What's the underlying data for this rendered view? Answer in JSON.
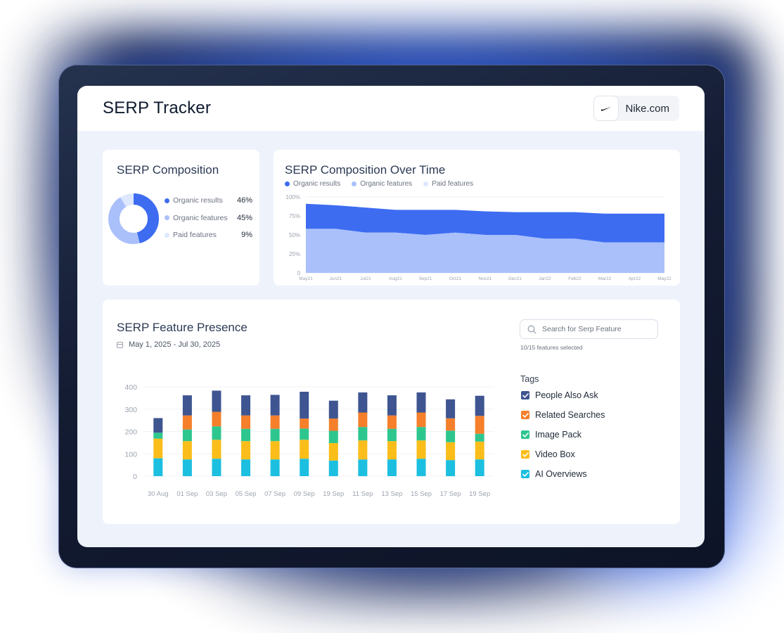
{
  "app": {
    "title": "SERP Tracker",
    "domain": "Nike.com"
  },
  "colors": {
    "organic_results": "#3d6cf1",
    "organic_features": "#a9c0fb",
    "paid_features": "#dde7fd",
    "people_also_ask": "#3e5591",
    "related_searches": "#f57f2b",
    "image_pack": "#2ec68f",
    "video_box": "#fbbd1a",
    "ai_overviews": "#1cbfe0"
  },
  "composition": {
    "title": "SERP Composition",
    "legend": [
      {
        "label": "Organic results",
        "pct": "46%",
        "value": 46,
        "color": "#3d6cf1"
      },
      {
        "label": "Organic features",
        "pct": "45%",
        "value": 45,
        "color": "#a9c0fb"
      },
      {
        "label": "Paid features",
        "pct": "9%",
        "value": 9,
        "color": "#dde7fd"
      }
    ]
  },
  "over_time": {
    "title": "SERP Composition Over Time",
    "legend": [
      {
        "label": "Organic results",
        "color": "#3d6cf1"
      },
      {
        "label": "Organic features",
        "color": "#a9c0fb"
      },
      {
        "label": "Paid features",
        "color": "#dde7fd"
      }
    ]
  },
  "presence": {
    "title": "SERP Feature Presence",
    "date_range": "May 1, 2025 - Jul 30, 2025",
    "search_placeholder": "Search for Serp Feature",
    "selected_count": "10/15 features selected",
    "tags_label": "Tags",
    "tags": [
      {
        "label": "People Also Ask",
        "color": "#3e5591",
        "checked": true
      },
      {
        "label": "Related Searches",
        "color": "#f57f2b",
        "checked": true
      },
      {
        "label": "Image Pack",
        "color": "#2ec68f",
        "checked": true
      },
      {
        "label": "Video Box",
        "color": "#fbbd1a",
        "checked": true
      },
      {
        "label": "AI Overviews",
        "color": "#1cbfe0",
        "checked": true
      }
    ]
  },
  "chart_data": [
    {
      "type": "area",
      "title": "SERP Composition Over Time",
      "x": [
        "May21",
        "Jun21",
        "Jul21",
        "Aug21",
        "Sep21",
        "Oct21",
        "Nov21",
        "Dec21",
        "Jan22",
        "Feb22",
        "Mar22",
        "Apr22",
        "May22"
      ],
      "ylim": [
        0,
        100
      ],
      "yticks": [
        "0",
        "25%",
        "50%",
        "75%",
        "100%"
      ],
      "stacked": true,
      "series": [
        {
          "name": "Organic features",
          "values": [
            58,
            58,
            53,
            53,
            50,
            53,
            50,
            50,
            45,
            45,
            40,
            40,
            40
          ]
        },
        {
          "name": "Organic results",
          "values": [
            33,
            31,
            33,
            30,
            33,
            30,
            31,
            30,
            35,
            35,
            38,
            38,
            38
          ]
        }
      ]
    },
    {
      "type": "bar",
      "title": "SERP Feature Presence",
      "categories": [
        "30 Aug",
        "01 Sep",
        "03 Sep",
        "05 Sep",
        "07 Sep",
        "09 Sep",
        "19 Sep",
        "11 Sep",
        "13 Sep",
        "15 Sep",
        "17 Sep",
        "19 Sep"
      ],
      "ylim": [
        0,
        400
      ],
      "yticks": [
        "0",
        "100",
        "200",
        "300",
        "400"
      ],
      "stacked": true,
      "series": [
        {
          "name": "AI Overviews",
          "values": [
            80,
            75,
            78,
            75,
            75,
            78,
            70,
            75,
            75,
            78,
            72,
            75
          ]
        },
        {
          "name": "Video Box",
          "values": [
            88,
            82,
            85,
            82,
            82,
            85,
            78,
            85,
            82,
            82,
            80,
            80
          ]
        },
        {
          "name": "Image Pack",
          "values": [
            27,
            52,
            60,
            55,
            55,
            50,
            55,
            60,
            55,
            60,
            52,
            35
          ]
        },
        {
          "name": "Related Searches",
          "values": [
            0,
            63,
            65,
            60,
            60,
            45,
            55,
            65,
            60,
            65,
            55,
            80
          ]
        },
        {
          "name": "People Also Ask",
          "values": [
            65,
            90,
            95,
            90,
            92,
            120,
            80,
            90,
            90,
            90,
            85,
            90
          ]
        }
      ]
    }
  ]
}
